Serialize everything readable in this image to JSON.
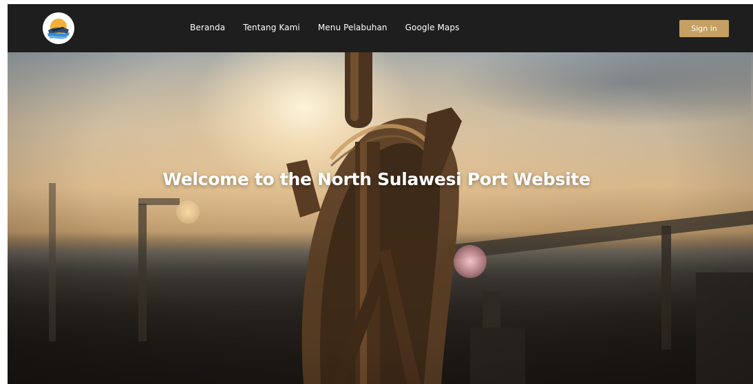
{
  "header": {
    "logo_icon": "port-ship-logo-icon",
    "nav": [
      {
        "label": "Beranda"
      },
      {
        "label": "Tentang Kami"
      },
      {
        "label": "Menu Pelabuhan"
      },
      {
        "label": "Google Maps"
      }
    ],
    "signin_label": "Sign in"
  },
  "hero": {
    "headline": "Welcome to the North Sulawesi Port Website",
    "background": "ship-steering-wheel-at-sunset-photo"
  },
  "colors": {
    "navbar_bg": "#1e1e1e",
    "accent": "#c6a062",
    "text": "#ffffff"
  }
}
